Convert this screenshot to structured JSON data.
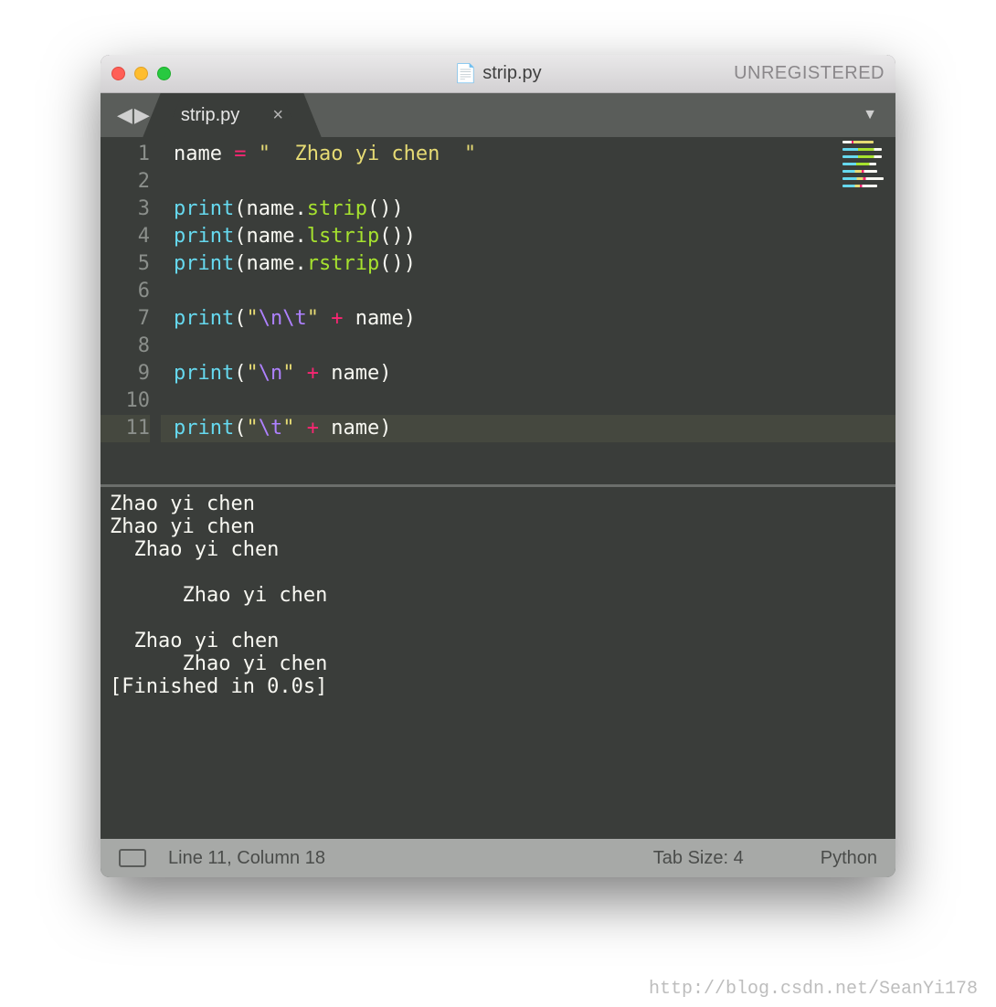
{
  "window": {
    "title": "strip.py",
    "unregistered": "UNREGISTERED"
  },
  "tab": {
    "label": "strip.py",
    "close_glyph": "×"
  },
  "nav": {
    "back_glyph": "◀",
    "fwd_glyph": "▶",
    "dropdown_glyph": "▼"
  },
  "gutter_lines": [
    "1",
    "2",
    "3",
    "4",
    "5",
    "6",
    "7",
    "8",
    "9",
    "10",
    "11"
  ],
  "current_line_index": 10,
  "code_lines": [
    [
      {
        "t": "name ",
        "c": "var"
      },
      {
        "t": "=",
        "c": "op"
      },
      {
        "t": " ",
        "c": "var"
      },
      {
        "t": "\"  Zhao yi chen  \"",
        "c": "str"
      }
    ],
    [],
    [
      {
        "t": "print",
        "c": "call"
      },
      {
        "t": "(",
        "c": "pn"
      },
      {
        "t": "name",
        "c": "var"
      },
      {
        "t": ".",
        "c": "pn"
      },
      {
        "t": "strip",
        "c": "fn"
      },
      {
        "t": "())",
        "c": "pn"
      }
    ],
    [
      {
        "t": "print",
        "c": "call"
      },
      {
        "t": "(",
        "c": "pn"
      },
      {
        "t": "name",
        "c": "var"
      },
      {
        "t": ".",
        "c": "pn"
      },
      {
        "t": "lstrip",
        "c": "fn"
      },
      {
        "t": "())",
        "c": "pn"
      }
    ],
    [
      {
        "t": "print",
        "c": "call"
      },
      {
        "t": "(",
        "c": "pn"
      },
      {
        "t": "name",
        "c": "var"
      },
      {
        "t": ".",
        "c": "pn"
      },
      {
        "t": "rstrip",
        "c": "fn"
      },
      {
        "t": "())",
        "c": "pn"
      }
    ],
    [],
    [
      {
        "t": "print",
        "c": "call"
      },
      {
        "t": "(",
        "c": "pn"
      },
      {
        "t": "\"",
        "c": "str"
      },
      {
        "t": "\\n\\t",
        "c": "esc"
      },
      {
        "t": "\"",
        "c": "str"
      },
      {
        "t": " ",
        "c": "var"
      },
      {
        "t": "+",
        "c": "op"
      },
      {
        "t": " name",
        "c": "var"
      },
      {
        "t": ")",
        "c": "pn"
      }
    ],
    [],
    [
      {
        "t": "print",
        "c": "call"
      },
      {
        "t": "(",
        "c": "pn"
      },
      {
        "t": "\"",
        "c": "str"
      },
      {
        "t": "\\n",
        "c": "esc"
      },
      {
        "t": "\"",
        "c": "str"
      },
      {
        "t": " ",
        "c": "var"
      },
      {
        "t": "+",
        "c": "op"
      },
      {
        "t": " name",
        "c": "var"
      },
      {
        "t": ")",
        "c": "pn"
      }
    ],
    [],
    [
      {
        "t": "print",
        "c": "call"
      },
      {
        "t": "(",
        "c": "pn"
      },
      {
        "t": "\"",
        "c": "str"
      },
      {
        "t": "\\t",
        "c": "esc"
      },
      {
        "t": "\"",
        "c": "str"
      },
      {
        "t": " ",
        "c": "var"
      },
      {
        "t": "+",
        "c": "op"
      },
      {
        "t": " name",
        "c": "var"
      },
      {
        "t": ")",
        "c": "pn"
      }
    ]
  ],
  "console_output": "Zhao yi chen\nZhao yi chen  \n  Zhao yi chen\n\n      Zhao yi chen  \n\n  Zhao yi chen  \n      Zhao yi chen  \n[Finished in 0.0s]",
  "status": {
    "position": "Line 11, Column 18",
    "tabsize": "Tab Size: 4",
    "syntax": "Python"
  },
  "minimap_colors": [
    "linear-gradient(90deg,#f8f8f2 0 30%, #f92672 30% 36%, #e6db74 36% 100%)",
    "linear-gradient(90deg,#66d9ef 0 40%, #a6e22e 40% 80%, #f8f8f2 80% 100%)",
    "linear-gradient(90deg,#66d9ef 0 40%, #a6e22e 40% 80%, #f8f8f2 80% 100%)",
    "linear-gradient(90deg,#66d9ef 0 40%, #a6e22e 40% 80%, #f8f8f2 80% 100%)",
    "linear-gradient(90deg,#66d9ef 0 35%, #e6db74 35% 55%, #f92672 55% 62%, #f8f8f2 62% 100%)",
    "linear-gradient(90deg,#66d9ef 0 35%, #e6db74 35% 50%, #f92672 50% 57%, #f8f8f2 57% 100%)",
    "linear-gradient(90deg,#66d9ef 0 35%, #e6db74 35% 50%, #f92672 50% 57%, #f8f8f2 57% 100%)"
  ],
  "watermark": "http://blog.csdn.net/SeanYi178"
}
